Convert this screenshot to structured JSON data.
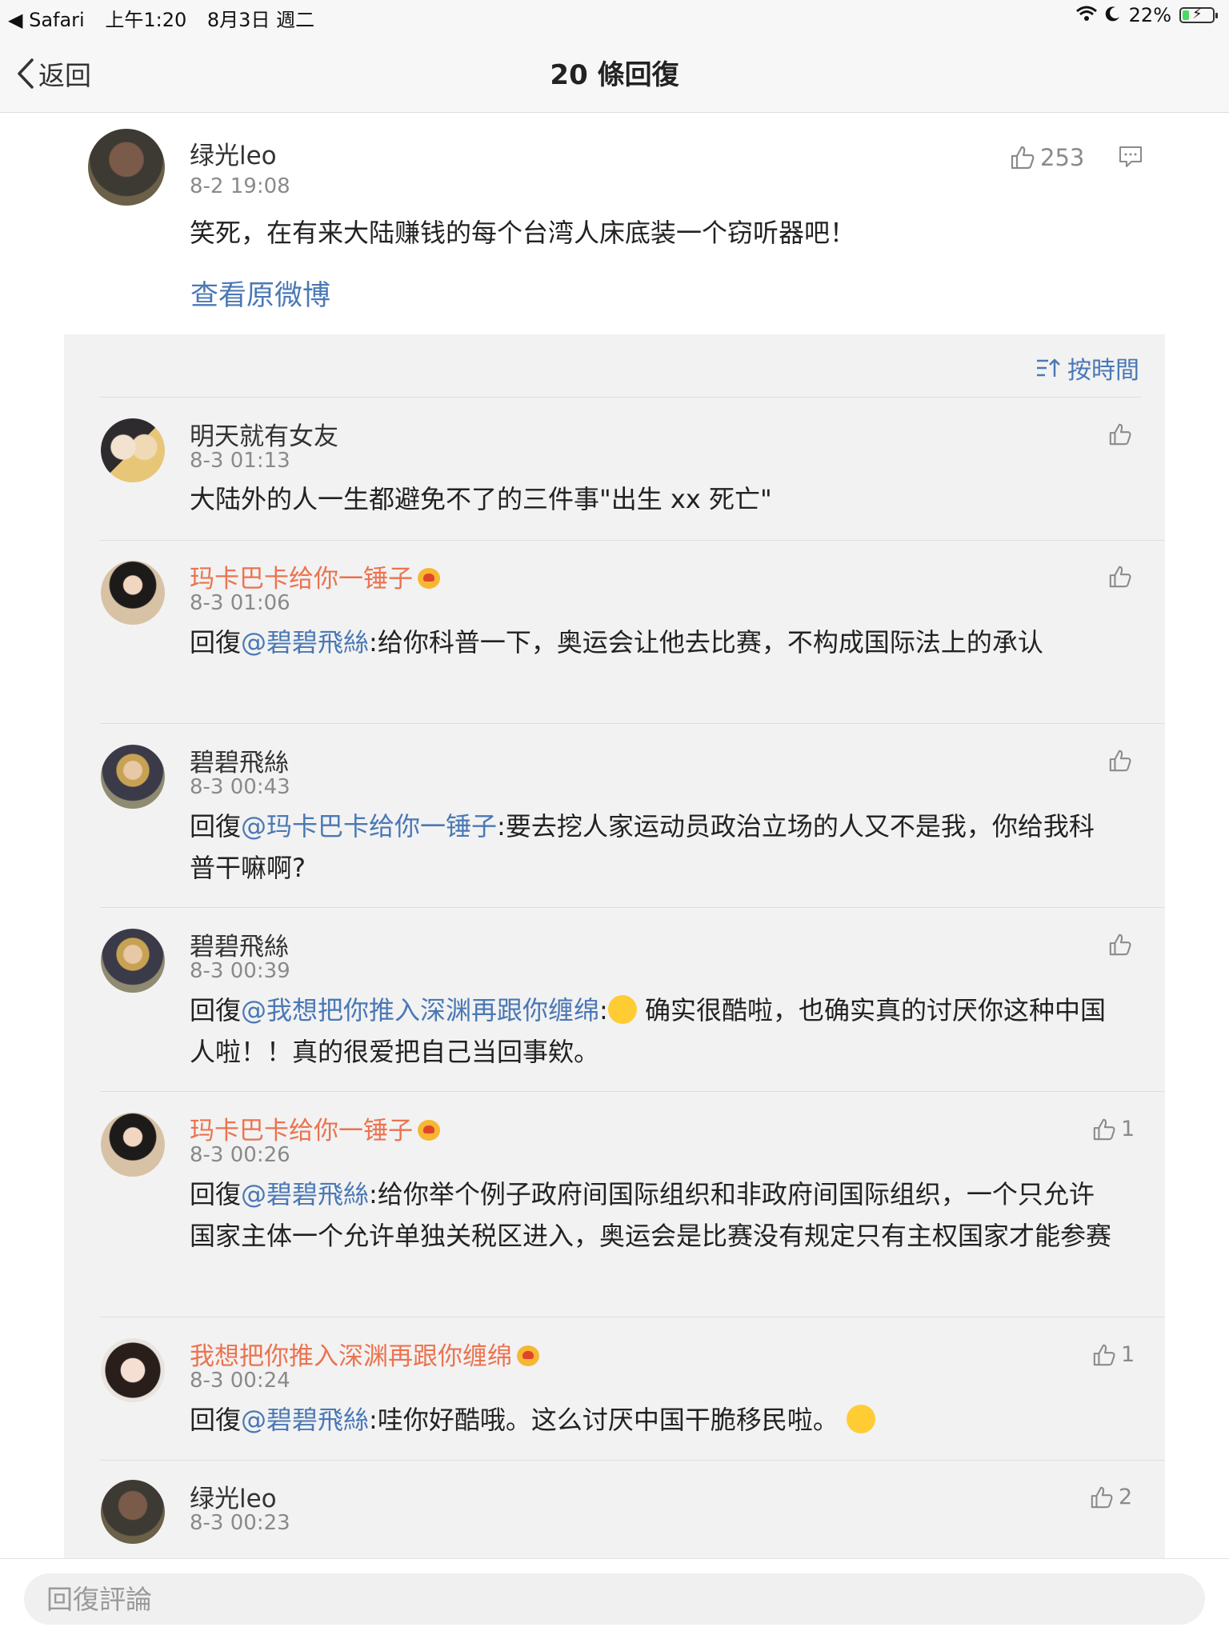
{
  "status_bar": {
    "back_app": "◀ Safari",
    "time": "上午1:20",
    "date": "8月3日 週二",
    "battery": "22%",
    "battery_level": 0.22
  },
  "nav": {
    "back_label": "返回",
    "title": "20 條回復"
  },
  "main_post": {
    "user": "绿光leo",
    "time": "8-2 19:08",
    "likes": "253",
    "text": "笑死，在有来大陆赚钱的每个台湾人床底装一个窃听器吧！",
    "view_original": "查看原微博"
  },
  "comments_header": {
    "sort_label": "按時間"
  },
  "comments": [
    {
      "user": "明天就有女友",
      "time": "8-3 01:13",
      "text": "大陆外的人一生都避免不了的三件事\"出生 xx 死亡\"",
      "likes": ""
    },
    {
      "user": "玛卡巴卡给你一锤子",
      "time": "8-3 01:06",
      "reply_prefix": "回復",
      "mention": "@碧碧飛絲",
      "text": ":给你科普一下，奥运会让他去比赛，不构成国际法上的承认",
      "likes": ""
    },
    {
      "user": "碧碧飛絲",
      "time": "8-3 00:43",
      "reply_prefix": "回復",
      "mention": "@玛卡巴卡给你一锤子",
      "text": ":要去挖人家运动员政治立场的人又不是我，你给我科普干嘛啊?",
      "likes": ""
    },
    {
      "user": "碧碧飛絲",
      "time": "8-3 00:39",
      "reply_prefix": "回復",
      "mention": "@我想把你推入深渊再跟你缠绵",
      "text": " 确实很酷啦，也确实真的讨厌你这种中国人啦！！真的很爱把自己当回事欸。",
      "likes": ""
    },
    {
      "user": "玛卡巴卡给你一锤子",
      "time": "8-3 00:26",
      "reply_prefix": "回復",
      "mention": "@碧碧飛絲",
      "text": ":给你举个例子政府间国际组织和非政府间国际组织，一个只允许国家主体一个允许单独关税区进入，奥运会是比赛没有规定只有主权国家才能参赛",
      "likes": "1"
    },
    {
      "user": "我想把你推入深渊再跟你缠绵",
      "time": "8-3 00:24",
      "reply_prefix": "回復",
      "mention": "@碧碧飛絲",
      "text": ":哇你好酷哦。这么讨厌中国干脆移民啦。",
      "likes": "1"
    },
    {
      "user": "绿光leo",
      "time": "8-3 00:23",
      "likes": "2"
    }
  ],
  "bottom": {
    "reply_placeholder": "回復評論"
  },
  "colors": {
    "mention_blue": "#4a78b5",
    "orange_name": "#eb7350",
    "panel_bg": "#f2f2f2"
  }
}
